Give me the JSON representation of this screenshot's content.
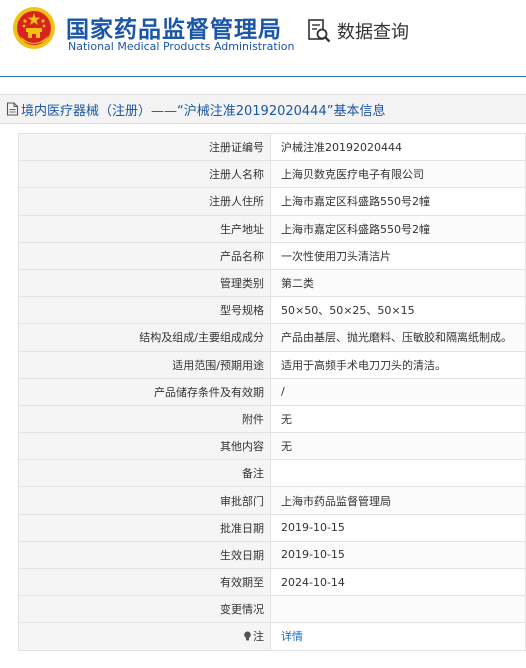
{
  "header": {
    "org_name_cn": "国家药品监督管理局",
    "org_name_en": "National Medical Products Administration",
    "query_label": "数据查询"
  },
  "title": "境内医疗器械（注册）——“沪械注准20192020444”基本信息",
  "rows": [
    {
      "label": "注册证编号",
      "value": "沪械注准20192020444"
    },
    {
      "label": "注册人名称",
      "value": "上海贝数克医疗电子有限公司"
    },
    {
      "label": "注册人住所",
      "value": "上海市嘉定区科盛路550号2幢"
    },
    {
      "label": "生产地址",
      "value": "上海市嘉定区科盛路550号2幢"
    },
    {
      "label": "产品名称",
      "value": "一次性使用刀头清洁片"
    },
    {
      "label": "管理类别",
      "value": "第二类"
    },
    {
      "label": "型号规格",
      "value": "50×50、50×25、50×15"
    },
    {
      "label": "结构及组成/主要组成成分",
      "value": "产品由基层、抛光磨料、压敏胶和隔离纸制成。"
    },
    {
      "label": "适用范围/预期用途",
      "value": "适用于高频手术电刀刀头的清洁。"
    },
    {
      "label": "产品储存条件及有效期",
      "value": "/"
    },
    {
      "label": "附件",
      "value": "无"
    },
    {
      "label": "其他内容",
      "value": "无"
    },
    {
      "label": "备注",
      "value": ""
    },
    {
      "label": "审批部门",
      "value": "上海市药品监督管理局"
    },
    {
      "label": "批准日期",
      "value": "2019-10-15"
    },
    {
      "label": "生效日期",
      "value": "2019-10-15"
    },
    {
      "label": "有效期至",
      "value": "2024-10-14"
    },
    {
      "label": "变更情况",
      "value": ""
    }
  ],
  "note_row": {
    "label": "注",
    "link_text": "详情",
    "icon": "lightbulb-icon"
  },
  "colors": {
    "brand_blue": "#1b56a8",
    "emblem_red": "#d8241f",
    "emblem_gold": "#f2c118",
    "link": "#1c6ec2"
  }
}
